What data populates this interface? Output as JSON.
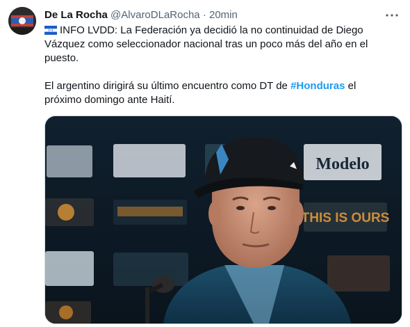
{
  "author": {
    "name": "De La Rocha",
    "handle": "@AlvaroDLaRocha",
    "separator": "·",
    "time": "20min"
  },
  "icons": {
    "more": "more-horizontal-icon",
    "flag": "honduras-flag-emoji"
  },
  "tweet": {
    "p1": "INFO LVDD: La Federación ya decidió la no continuidad de Diego Vázquez como seleccionador nacional tras un poco más del año en el puesto.",
    "p2_before": "El argentino dirigirá su último encuentro como DT de ",
    "hashtag": "#Honduras",
    "p2_after": " el próximo domingo ante Haití."
  },
  "media": {
    "backdrop_labels": [
      "Modelo",
      "THIS IS OURS"
    ]
  },
  "colors": {
    "link": "#1d9bf0",
    "secondary": "#536471",
    "text": "#0f1419"
  }
}
